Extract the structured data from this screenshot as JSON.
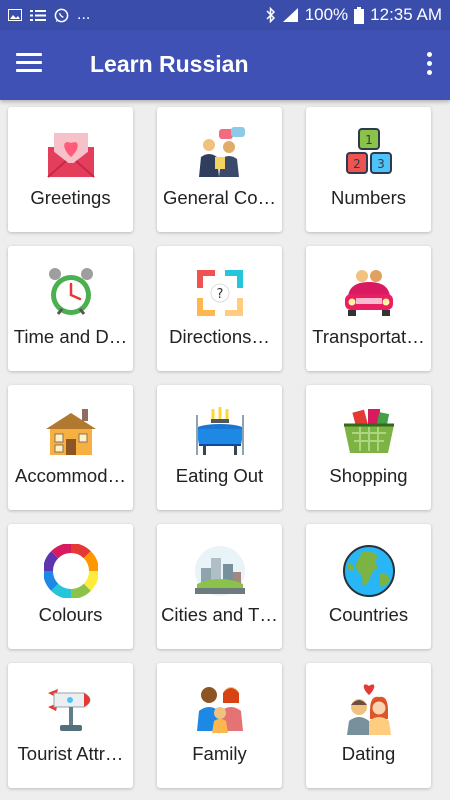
{
  "status_bar": {
    "time": "12:35 AM",
    "battery": "100%",
    "left_icons": [
      "image-icon",
      "list-icon",
      "whatsapp-icon",
      "more-notifications-icon"
    ],
    "more_text": "..."
  },
  "app_bar": {
    "title": "Learn Russian",
    "menu_icon": "hamburger-menu-icon",
    "overflow_icon": "more-vert-icon"
  },
  "categories": [
    {
      "label": "Greetings",
      "icon": "envelope-heart-icon"
    },
    {
      "label": "General Co…",
      "icon": "conversation-icon"
    },
    {
      "label": "Numbers",
      "icon": "number-blocks-icon"
    },
    {
      "label": "Time and D…",
      "icon": "alarm-clock-icon"
    },
    {
      "label": "Directions…",
      "icon": "directions-arrows-icon"
    },
    {
      "label": "Transportat…",
      "icon": "car-icon"
    },
    {
      "label": "Accommod…",
      "icon": "house-icon"
    },
    {
      "label": "Eating Out",
      "icon": "dining-table-icon"
    },
    {
      "label": "Shopping",
      "icon": "shopping-basket-icon"
    },
    {
      "label": "Colours",
      "icon": "color-wheel-icon"
    },
    {
      "label": "Cities and T…",
      "icon": "city-icon"
    },
    {
      "label": "Countries",
      "icon": "globe-icon"
    },
    {
      "label": "Tourist Attr…",
      "icon": "rocket-icon"
    },
    {
      "label": "Family",
      "icon": "family-icon"
    },
    {
      "label": "Dating",
      "icon": "couple-icon"
    }
  ],
  "colors": {
    "status_bar": "#3a4dab",
    "app_bar": "#3f51b5",
    "background": "#eeeeee",
    "card": "#ffffff"
  }
}
